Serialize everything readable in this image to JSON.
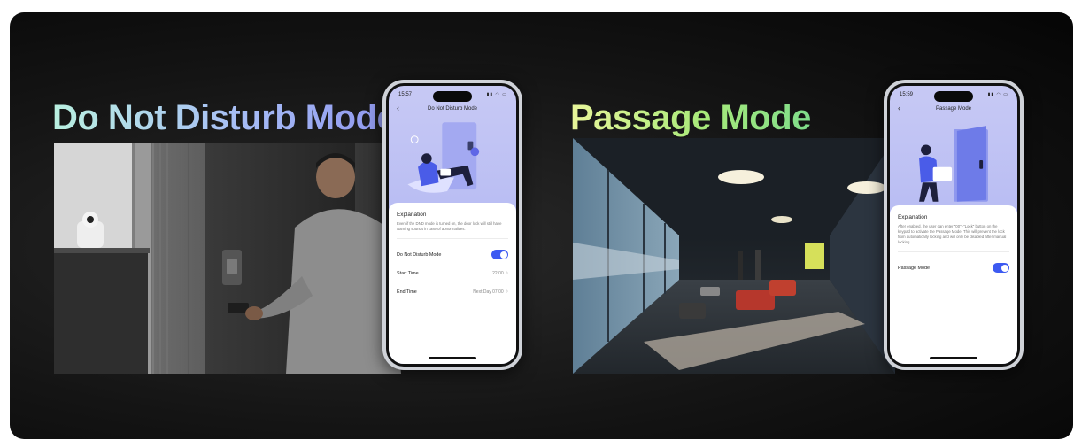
{
  "dnd": {
    "headline": "Do Not Disturb Mode",
    "phone": {
      "time": "15:57",
      "title": "Do Not Disturb Mode",
      "explanation_title": "Explanation",
      "explanation_text": "Even if the DND mode is turned on, the door lock will still have warning sounds in case of abnormalities.",
      "rows": [
        {
          "label": "Do Not Disturb Mode",
          "toggle_on": true
        },
        {
          "label": "Start Time",
          "value": "22:00"
        },
        {
          "label": "End Time",
          "value": "Next Day 07:00"
        }
      ]
    }
  },
  "passage": {
    "headline": "Passage Mode",
    "phone": {
      "time": "15:59",
      "title": "Passage Mode",
      "explanation_title": "Explanation",
      "explanation_text": "After enabled, the user can enter \"00\"+\"Lock\" button on the keypad to activate the Passage Mode. This will prevent the lock from automatically locking and will only be disabled after manual locking.",
      "rows": [
        {
          "label": "Passage Mode",
          "toggle_on": true
        }
      ]
    }
  },
  "colors": {
    "toggle": "#3d5af1",
    "screen_bg": "#c7c9f4",
    "card_bg": "#141414"
  }
}
